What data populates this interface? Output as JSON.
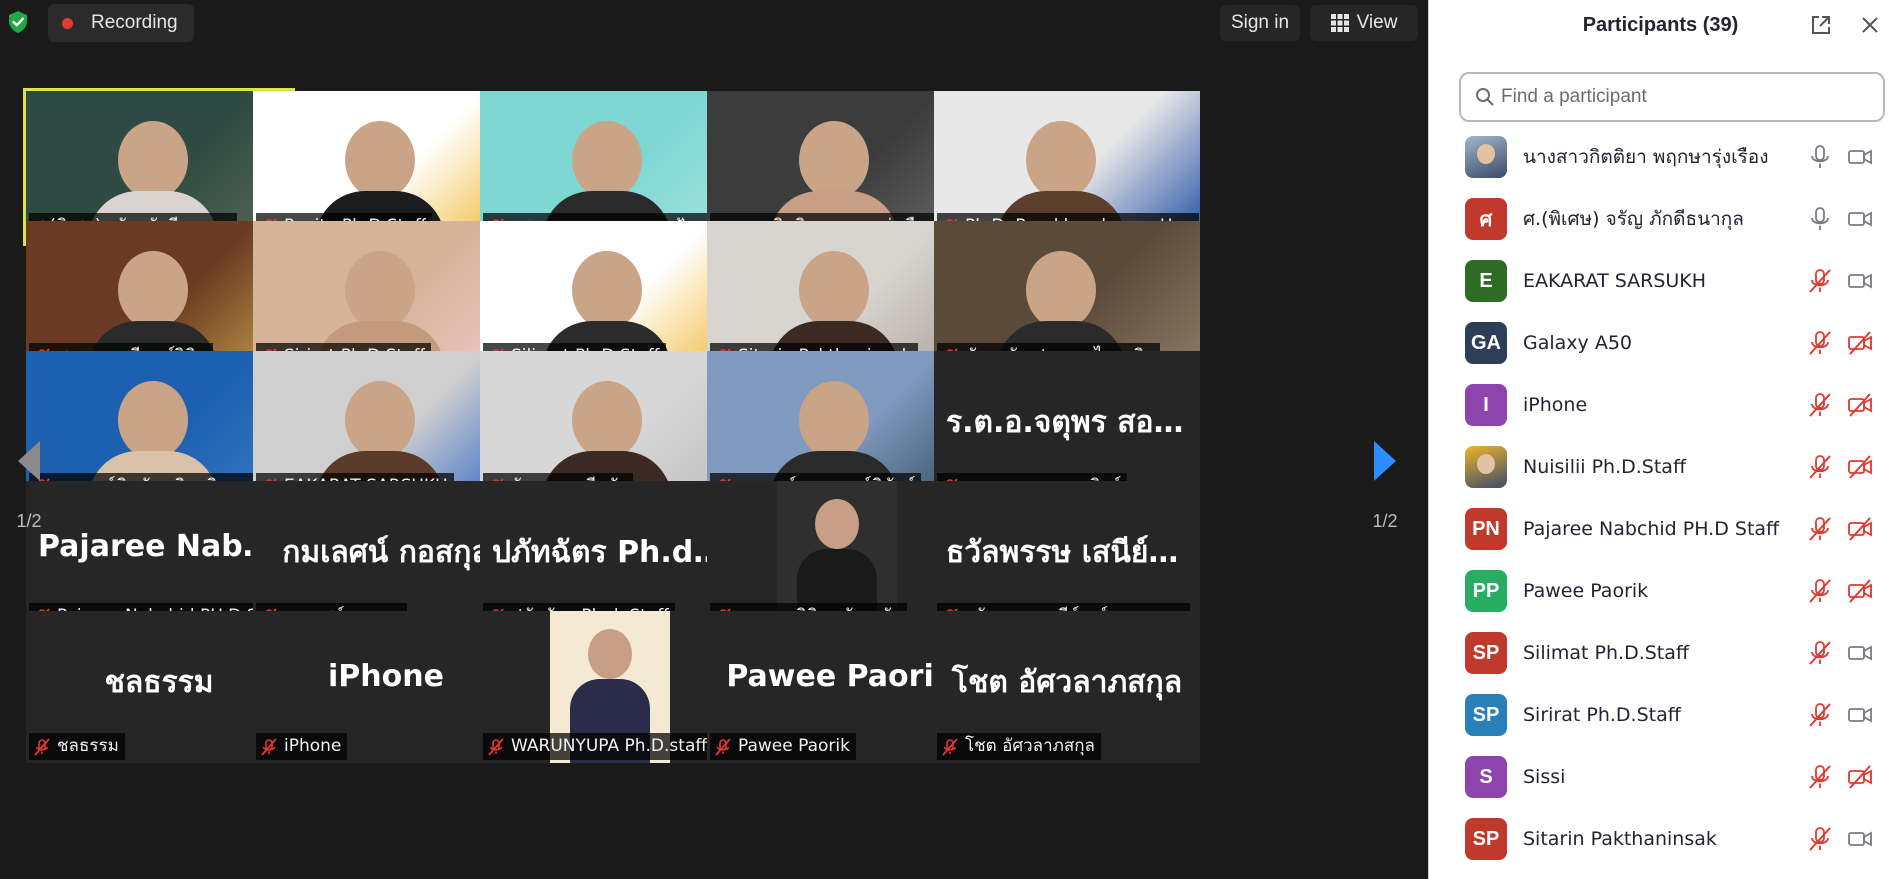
{
  "topbar": {
    "recording_label": "Recording",
    "sign_in_label": "Sign in",
    "view_label": "View"
  },
  "nav": {
    "page_left": "1/2",
    "page_right": "1/2"
  },
  "tiles": [
    {
      "name": "ศ.(พิเศษ) จรัญ ภักดีธนากุล",
      "muted": false,
      "video": true,
      "bg": "#2f4a42",
      "bg2": "#5a6b57",
      "person": "#d9d4cf",
      "active": true,
      "big": ""
    },
    {
      "name": "Panita Ph.D.Staff",
      "muted": true,
      "video": true,
      "bg": "#ffffff",
      "bg2": "#f0b429",
      "person": "#1c1c1c",
      "active": false,
      "big": ""
    },
    {
      "name": "รศ. แพรวพรรณ หลายปัญญา",
      "muted": true,
      "video": true,
      "bg": "#7fd7d3",
      "bg2": "#a8e4df",
      "person": "#2a2a2a",
      "active": false,
      "big": ""
    },
    {
      "name": "นางสาวกิตติยา พฤกษารุ่งเรือง",
      "muted": false,
      "video": true,
      "bg": "#3c3c3c",
      "bg2": "#6b6b6b",
      "person": "#c89f86",
      "active": false,
      "big": ""
    },
    {
      "name": "Ph.D. Ramkhamhaeng University",
      "muted": true,
      "video": true,
      "bg": "#e8e8e8",
      "bg2": "#1f4fa3",
      "person": "#5c3e2c",
      "active": false,
      "big": ""
    },
    {
      "name": "ศ.ดร.สุมาลี วงษ์วิทิต",
      "muted": true,
      "video": true,
      "bg": "#6a3b22",
      "bg2": "#c8a24a",
      "person": "#2a2a2a",
      "active": false,
      "big": ""
    },
    {
      "name": "Sirirat Ph.D.Staff",
      "muted": true,
      "video": true,
      "bg": "#d6b49a",
      "bg2": "#f1c9c9",
      "person": "#c49a7c",
      "active": false,
      "big": ""
    },
    {
      "name": "Silimat Ph.D.Staff",
      "muted": true,
      "video": true,
      "bg": "#ffffff",
      "bg2": "#f0b429",
      "person": "#2b2b2b",
      "active": false,
      "big": ""
    },
    {
      "name": "Sitarin Pakthaninsak",
      "muted": true,
      "video": true,
      "bg": "#d8d4cf",
      "bg2": "#a9a39b",
      "person": "#3a2a22",
      "active": false,
      "big": ""
    },
    {
      "name": "ทัดตะวัน ประกอบไวทยกิจ",
      "muted": true,
      "video": true,
      "bg": "#5a4a3a",
      "bg2": "#8b7a64",
      "person": "#2a2a2a",
      "active": false,
      "big": ""
    },
    {
      "name": "อาจารย์ชินภัทร วิสุทธิแพทย์",
      "muted": true,
      "video": true,
      "bg": "#1d5fb0",
      "bg2": "#3a7bc8",
      "person": "#d9c2a8",
      "active": false,
      "big": ""
    },
    {
      "name": "EAKARAT SARSUKH",
      "muted": true,
      "video": true,
      "bg": "#cfcfcf",
      "bg2": "#2a64c6",
      "person": "#5b3b28",
      "active": false,
      "big": ""
    },
    {
      "name": "จักรวาล กลีบบัว",
      "muted": true,
      "video": true,
      "bg": "#d7d7d7",
      "bg2": "#bdbdbd",
      "person": "#3a2a22",
      "active": false,
      "big": ""
    },
    {
      "name": "อาจารย์สุเทพ พงษ์พิทักษ์",
      "muted": true,
      "video": true,
      "bg": "#7f9bbf",
      "bg2": "#34495e",
      "person": "#2a2a2a",
      "active": false,
      "big": ""
    },
    {
      "name": "ร.ต.อ.จตุพร สอนวิทย์",
      "muted": true,
      "video": false,
      "bg": "",
      "bg2": "",
      "person": "",
      "active": false,
      "big": "ร.ต.อ.จตุพร สอนวิทย์"
    },
    {
      "name": "Pajaree Nabchid PH.D Staff",
      "muted": true,
      "video": false,
      "bg": "",
      "bg2": "",
      "person": "",
      "active": false,
      "big": "Pajaree Nabchid PH.D Staff"
    },
    {
      "name": "กมเลศน์ กอสกุล",
      "muted": true,
      "video": false,
      "bg": "",
      "bg2": "",
      "person": "",
      "active": false,
      "big": "กมเลศน์ กอสกุล"
    },
    {
      "name": "ปภัทฉัตร Ph.d. Staff",
      "muted": true,
      "video": false,
      "bg": "",
      "bg2": "",
      "person": "",
      "active": false,
      "big": "ปภัทฉัตร Ph.d. Staff"
    },
    {
      "name": "นางสาวฐิติพร วัฒนชัย",
      "muted": true,
      "video": true,
      "bg": "#262626",
      "bg2": "#2f2f2f",
      "person": "#1a1a1a",
      "active": false,
      "big": "",
      "portrait": true
    },
    {
      "name": "ธวัลพรรษ เสนีย์วงศ์ ณ อยุธยา",
      "muted": true,
      "video": false,
      "bg": "",
      "bg2": "",
      "person": "",
      "active": false,
      "big": "ธวัลพรรษ เสนีย์วงศ์ ณ อยุธยา"
    },
    {
      "name": "ชลธรรม",
      "muted": true,
      "video": false,
      "bg": "",
      "bg2": "",
      "person": "",
      "active": false,
      "big": "ชลธรรม"
    },
    {
      "name": "iPhone",
      "muted": true,
      "video": false,
      "bg": "",
      "bg2": "",
      "person": "",
      "active": false,
      "big": "iPhone"
    },
    {
      "name": "WARUNYUPA Ph.D.staff",
      "muted": true,
      "video": true,
      "bg": "#262626",
      "bg2": "#f4e9d2",
      "person": "#2b2b4a",
      "active": false,
      "big": "",
      "portrait": true
    },
    {
      "name": "Pawee Paorik",
      "muted": true,
      "video": false,
      "bg": "",
      "bg2": "",
      "person": "",
      "active": false,
      "big": "Pawee Paorik"
    },
    {
      "name": "โชต อัศวลาภสกุล",
      "muted": true,
      "video": false,
      "bg": "",
      "bg2": "",
      "person": "",
      "active": false,
      "big": "โชต อัศวลาภสกุล"
    }
  ],
  "panel": {
    "title": "Participants (39)",
    "search_placeholder": "Find a participant",
    "participants": [
      {
        "name": "นางสาวกิตติยา พฤกษารุ่งเรือง",
        "initials": "",
        "color": "#9fb8c9",
        "mic": "on",
        "cam": "on"
      },
      {
        "name": "ศ.(พิเศษ) จรัญ ภักดีธนากุล",
        "initials": "ศ",
        "color": "#c0392b",
        "mic": "on",
        "cam": "on"
      },
      {
        "name": "EAKARAT SARSUKH",
        "initials": "E",
        "color": "#2e6b25",
        "mic": "off",
        "cam": "on"
      },
      {
        "name": "Galaxy A50",
        "initials": "GA",
        "color": "#2c3e58",
        "mic": "off",
        "cam": "off"
      },
      {
        "name": "iPhone",
        "initials": "I",
        "color": "#8e44ad",
        "mic": "off",
        "cam": "off"
      },
      {
        "name": "Nuisilii Ph.D.Staff",
        "initials": "",
        "color": "#f0b429",
        "mic": "off",
        "cam": "off"
      },
      {
        "name": "Pajaree Nabchid PH.D Staff",
        "initials": "PN",
        "color": "#c0392b",
        "mic": "off",
        "cam": "off"
      },
      {
        "name": "Pawee  Paorik",
        "initials": "PP",
        "color": "#27ae60",
        "mic": "off",
        "cam": "off"
      },
      {
        "name": "Silimat Ph.D.Staff",
        "initials": "SP",
        "color": "#c0392b",
        "mic": "off",
        "cam": "on"
      },
      {
        "name": "Sirirat Ph.D.Staff",
        "initials": "SP",
        "color": "#2980b9",
        "mic": "off",
        "cam": "on"
      },
      {
        "name": "Sissi",
        "initials": "S",
        "color": "#8e44ad",
        "mic": "off",
        "cam": "off"
      },
      {
        "name": "Sitarin Pakthaninsak",
        "initials": "SP",
        "color": "#c0392b",
        "mic": "off",
        "cam": "on"
      }
    ]
  },
  "colors": {
    "accent": "#0e72ed",
    "muted_red": "#e0392f",
    "active_border": "#d9e34a",
    "shield_green": "#23a645"
  }
}
